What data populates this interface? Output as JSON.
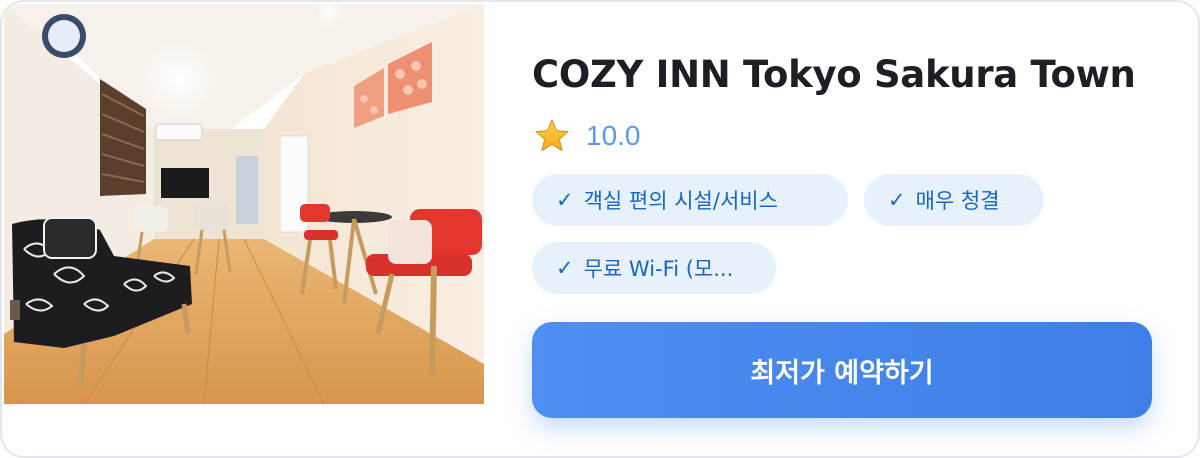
{
  "hotel": {
    "image_alt": "hotel-room-photo",
    "name": "COZY INN Tokyo Sakura Town",
    "rating_icon": "star-icon",
    "rating": "10.0"
  },
  "amenities": [
    {
      "check": "✓",
      "label": "객실 편의 시설/서비스"
    },
    {
      "check": "✓",
      "label": "매우 청결"
    },
    {
      "check": "✓",
      "label": "무료 Wi-Fi (모..."
    }
  ],
  "actions": {
    "book_label": "최저가 예약하기"
  },
  "colors": {
    "accent": "#4a89ee",
    "chip_background": "#e7f1fc",
    "chip_text": "#1666c6",
    "rating_text": "#5b9ae8",
    "title_text": "#1d1f24"
  }
}
